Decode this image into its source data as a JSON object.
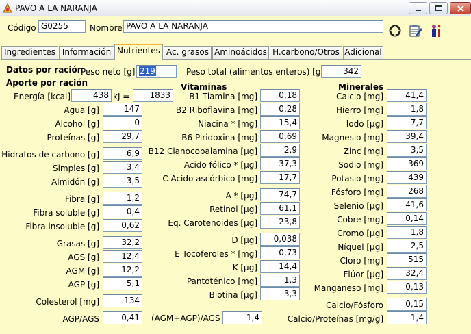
{
  "window": {
    "title": "PAVO A LA NARANJA"
  },
  "header": {
    "codigo_label": "Código",
    "codigo_value": "G0255",
    "nombre_label": "Nombre",
    "nombre_value": "PAVO A LA NARANJA"
  },
  "tabs": [
    "Ingredientes",
    "Información",
    "Nutrientes",
    "Ac. grasos",
    "Aminoácidos",
    "H.carbono/Otros",
    "Adicional"
  ],
  "racion": {
    "title": "Datos por ración",
    "peso_neto_label": "Peso neto [g]",
    "peso_neto_value": "219",
    "peso_total_label": "Peso total (alimentos enteros) [g]",
    "peso_total_value": "342"
  },
  "aporte": {
    "title": "Aporte por ración",
    "energia_label": "Energía [kcal]",
    "energia_kcal": "438",
    "kj_label": "kJ =",
    "energia_kj": "1833",
    "items": [
      {
        "label": "Agua [g]",
        "value": "147"
      },
      {
        "label": "Alcohol [g]",
        "value": "0"
      },
      {
        "label": "Proteínas [g]",
        "value": "29,7"
      },
      {
        "label": "Hidratos de carbono [g]",
        "value": "6,9"
      },
      {
        "label": "Simples [g]",
        "value": "3,4"
      },
      {
        "label": "Almidón [g]",
        "value": "3,5"
      },
      {
        "label": "Fibra [g]",
        "value": "1,2"
      },
      {
        "label": "Fibra soluble [g]",
        "value": "0,4"
      },
      {
        "label": "Fibra insoluble [g]",
        "value": "0,62"
      },
      {
        "label": "Grasas [g]",
        "value": "32,2"
      },
      {
        "label": "AGS [g]",
        "value": "12,4"
      },
      {
        "label": "AGM [g]",
        "value": "12,2"
      },
      {
        "label": "AGP [g]",
        "value": "5,1"
      },
      {
        "label": "Colesterol [mg]",
        "value": "134"
      },
      {
        "label": "AGP/AGS",
        "value": "0,41"
      }
    ]
  },
  "vitaminas": {
    "title": "Vitaminas",
    "items": [
      {
        "label": "B1 Tiamina [mg]",
        "value": "0,18"
      },
      {
        "label": "B2 Riboflavina [mg]",
        "value": "0,28"
      },
      {
        "label": "Niacina * [mg]",
        "value": "15,4"
      },
      {
        "label": "B6 Piridoxina [mg]",
        "value": "0,69"
      },
      {
        "label": "B12 Cianocobalamina [µg]",
        "value": "2,9"
      },
      {
        "label": "Acido fólico * [µg]",
        "value": "37,3"
      },
      {
        "label": "C Acido ascórbico [mg]",
        "value": "17,7"
      },
      {
        "label": "A * [µg]",
        "value": "74,7"
      },
      {
        "label": "Retinol [µg]",
        "value": "61,1"
      },
      {
        "label": "Eq. Carotenoides [µg]",
        "value": "23,8"
      },
      {
        "label": "D [µg]",
        "value": "0,038"
      },
      {
        "label": "E Tocoferoles * [mg]",
        "value": "0,73"
      },
      {
        "label": "K [µg]",
        "value": "14,4"
      },
      {
        "label": "Pantoténico [mg]",
        "value": "1,3"
      },
      {
        "label": "Biotina [µg]",
        "value": "3,3"
      }
    ],
    "ratio_label": "(AGM+AGP)/AGS",
    "ratio_value": "1,4"
  },
  "minerales": {
    "title": "Minerales",
    "items": [
      {
        "label": "Calcio [mg]",
        "value": "41,4"
      },
      {
        "label": "Hierro [mg]",
        "value": "1,8"
      },
      {
        "label": "Iodo [µg]",
        "value": "7,7"
      },
      {
        "label": "Magnesio [mg]",
        "value": "39,4"
      },
      {
        "label": "Zinc [mg]",
        "value": "3,5"
      },
      {
        "label": "Sodio [mg]",
        "value": "369"
      },
      {
        "label": "Potasio [mg]",
        "value": "439"
      },
      {
        "label": "Fósforo [mg]",
        "value": "268"
      },
      {
        "label": "Selenio [µg]",
        "value": "41,6"
      },
      {
        "label": "Cobre [mg]",
        "value": "0,14"
      },
      {
        "label": "Cromo [µg]",
        "value": "1,8"
      },
      {
        "label": "Níquel [µg]",
        "value": "2,5"
      },
      {
        "label": "Cloro [mg]",
        "value": "515"
      },
      {
        "label": "Flúor [µg]",
        "value": "32,4"
      },
      {
        "label": "Manganeso [mg]",
        "value": "0,13"
      },
      {
        "label": "Calcio/Fósforo",
        "value": "0,15"
      },
      {
        "label": "Calcio/Proteínas [mg/g]",
        "value": "1,4"
      }
    ]
  }
}
